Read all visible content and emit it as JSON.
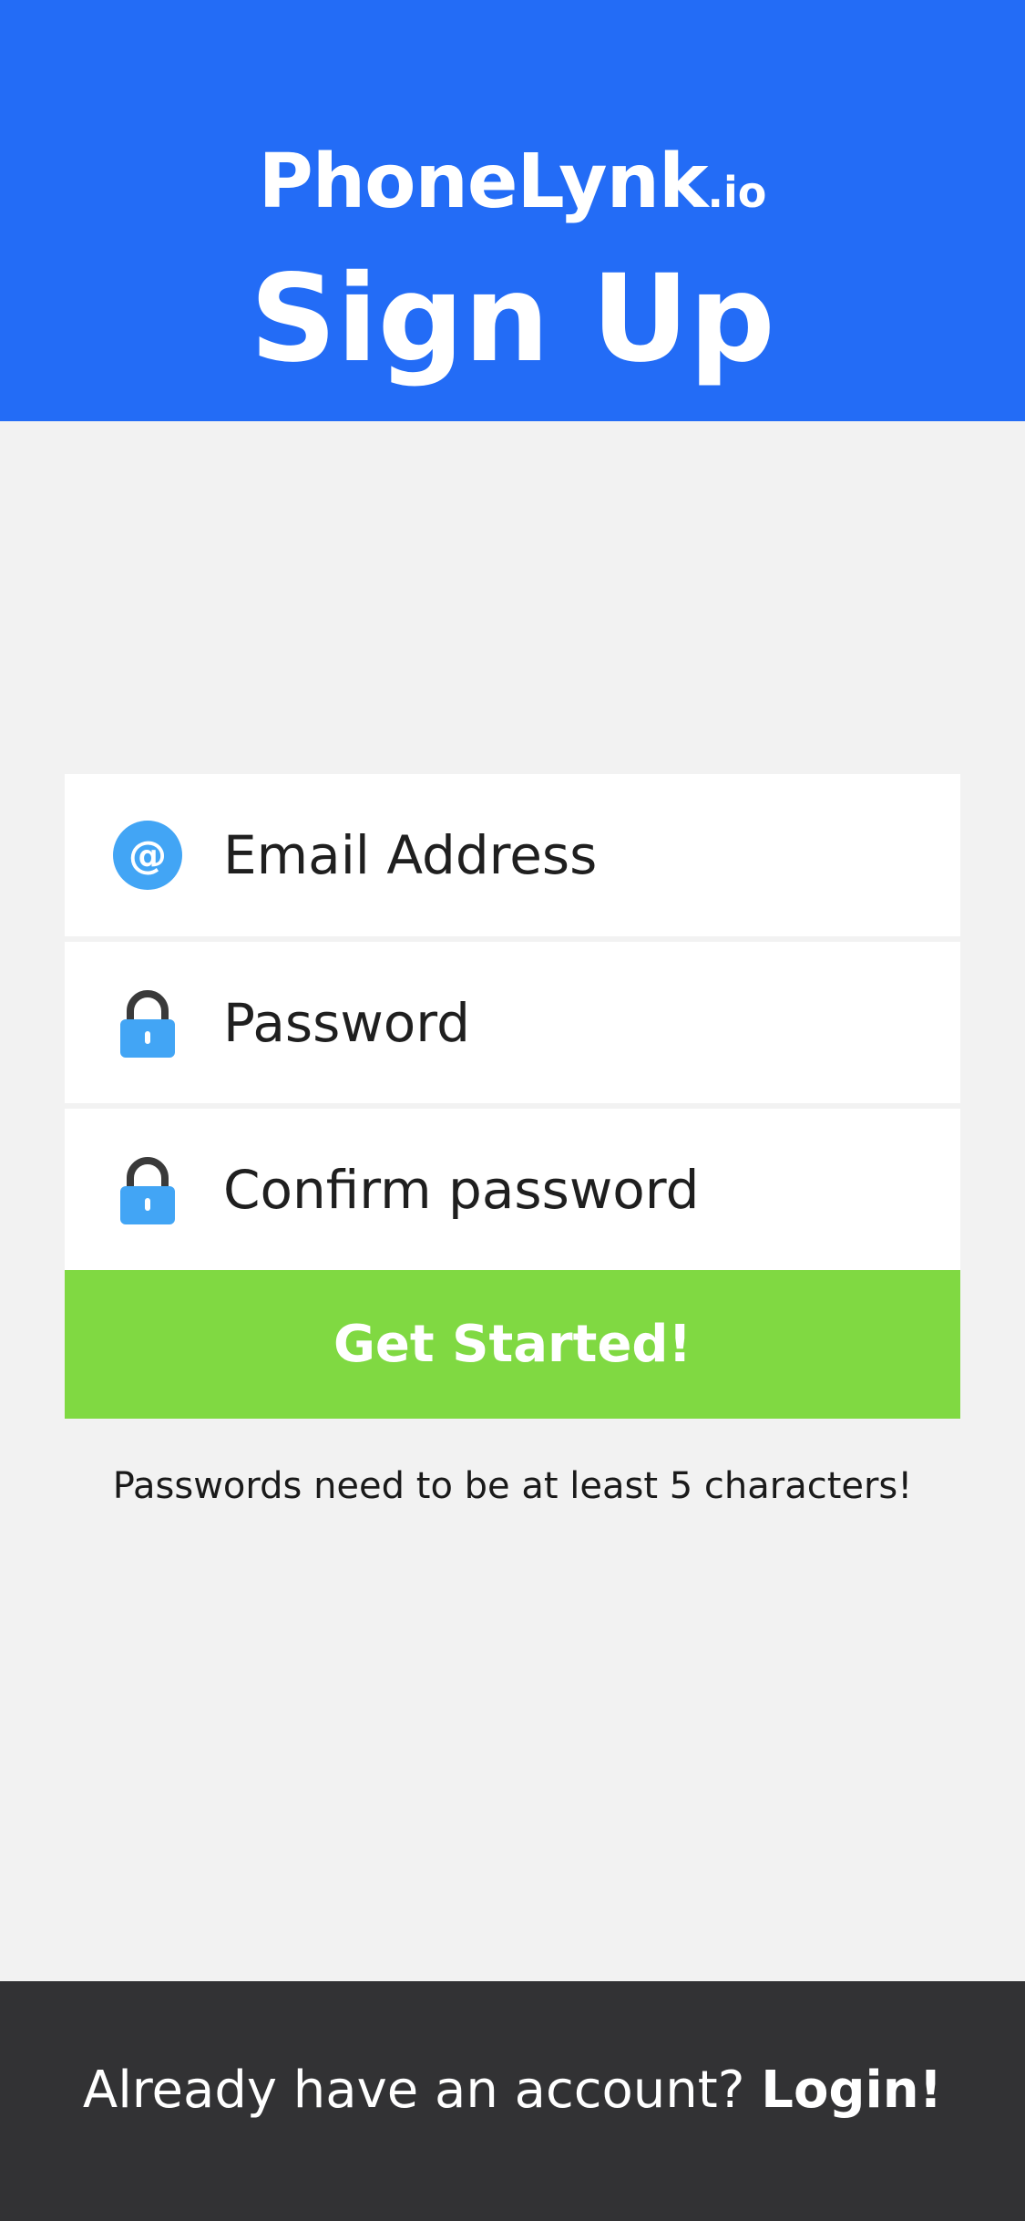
{
  "header": {
    "logo_main": "PhoneLynk",
    "logo_suffix": ".io",
    "title": "Sign Up"
  },
  "form": {
    "email": {
      "placeholder": "Email Address",
      "value": "",
      "icon": "at-sign-icon"
    },
    "password": {
      "placeholder": "Password",
      "value": "",
      "icon": "lock-icon"
    },
    "confirm_password": {
      "placeholder": "Confirm password",
      "value": "",
      "icon": "lock-icon"
    },
    "submit_label": "Get Started!",
    "hint": "Passwords need to be at least 5 characters!"
  },
  "footer": {
    "prompt": "Already have an account?",
    "login_label": "Login!"
  },
  "colors": {
    "header_bg": "#236cf6",
    "page_bg": "#f2f2f2",
    "button_bg": "#80d942",
    "footer_bg": "#323234",
    "icon_blue": "#42a5f5",
    "lock_shackle": "#3a3a3a"
  }
}
